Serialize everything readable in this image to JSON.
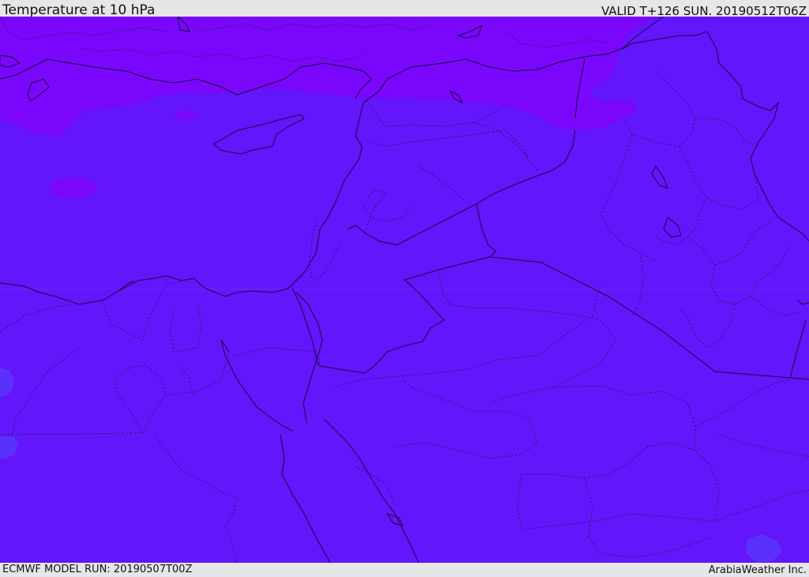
{
  "header": {
    "title": "Temperature at 10 hPa",
    "valid": "VALID T+126 SUN. 20190512T06Z"
  },
  "footer": {
    "model_run": "ECMWF MODEL RUN: 20190507T00Z",
    "credit": "ArabiaWeather Inc."
  },
  "map": {
    "field": "Temperature",
    "level": "10 hPa",
    "colors": {
      "base_fill": "#6315fc",
      "cold_band": "#7a07fb",
      "warm_patch": "#5a30fb",
      "coast_line": "#1a0a3a",
      "border_line": "#2a1a55"
    }
  }
}
